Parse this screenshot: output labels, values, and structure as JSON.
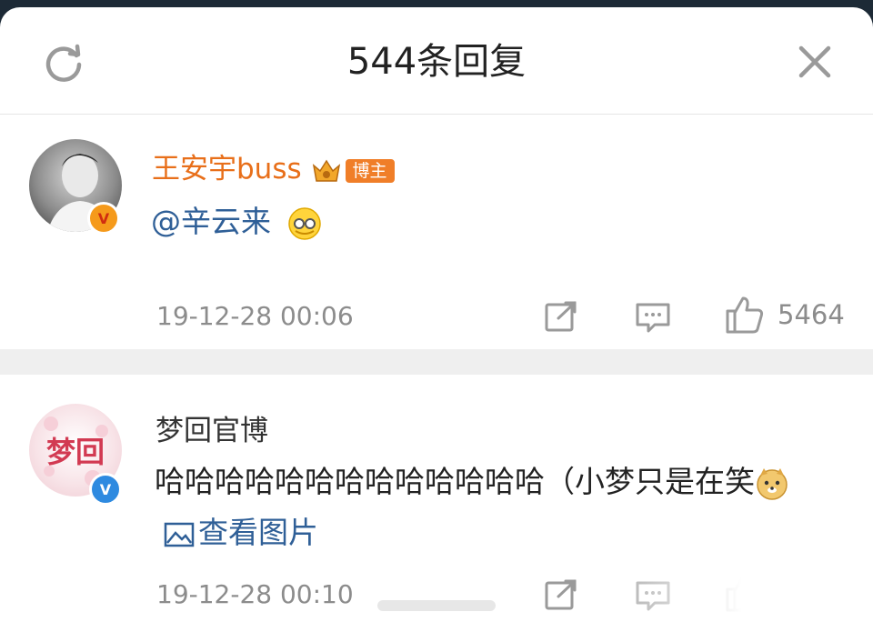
{
  "header": {
    "title": "544条回复",
    "refresh_icon": "refresh-icon",
    "close_icon": "close-icon"
  },
  "comments": [
    {
      "username": "王安宇buss",
      "username_color": "#e86f1a",
      "badge_text": "博主",
      "verified_badge": "gold-v",
      "mention": "@辛云来",
      "emoji": "covering-face-emoji",
      "time": "19-12-28 00:06",
      "like_count": "5464"
    },
    {
      "username": "梦回官博",
      "username_color": "#333333",
      "verified_badge": "blue-v",
      "avatar_text": "梦回",
      "text": "哈哈哈哈哈哈哈哈哈哈哈哈哈（小梦只是在笑",
      "emoji": "doge-emoji",
      "image_link": "查看图片",
      "time": "19-12-28 00:10",
      "like_count": ""
    }
  ],
  "colors": {
    "link": "#2f5f97",
    "meta": "#8c8c8c",
    "badge": "#f07e28"
  }
}
